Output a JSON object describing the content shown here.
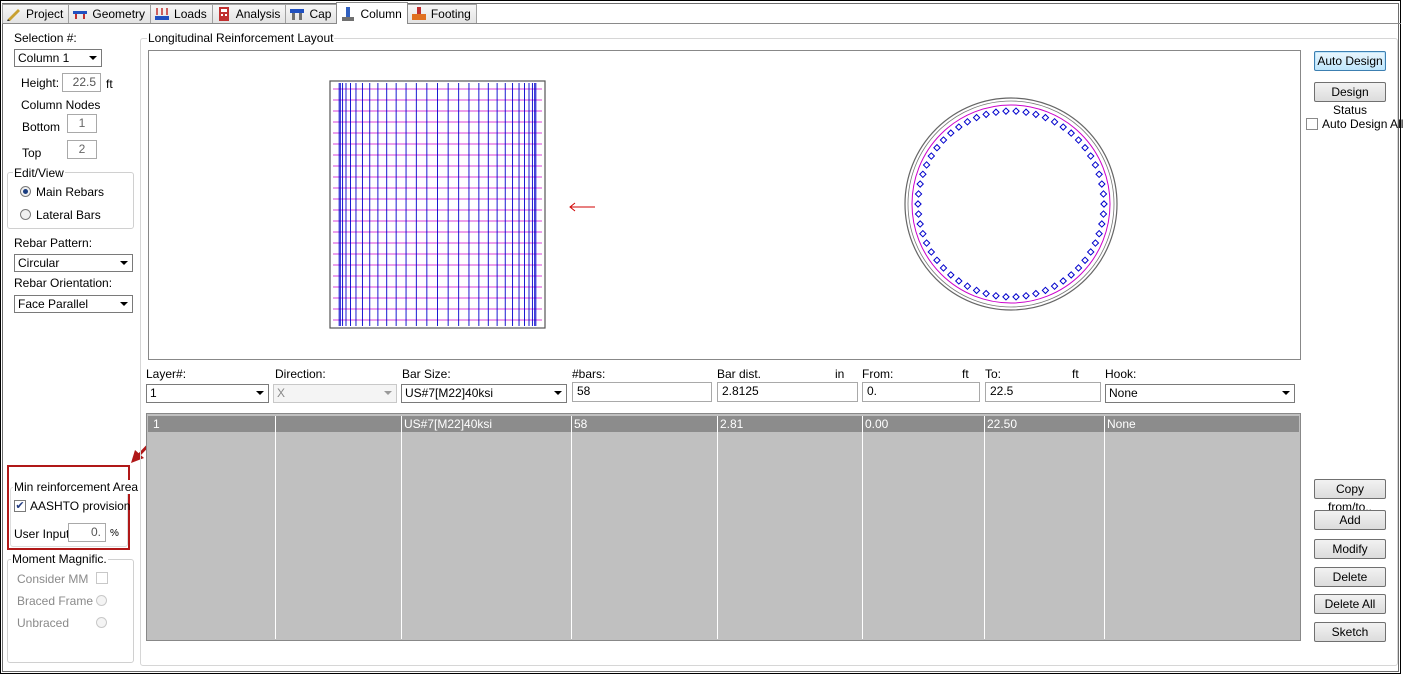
{
  "tabs": [
    {
      "label": "Project",
      "icon": "project-icon"
    },
    {
      "label": "Geometry",
      "icon": "geometry-icon"
    },
    {
      "label": "Loads",
      "icon": "loads-icon"
    },
    {
      "label": "Analysis",
      "icon": "analysis-icon"
    },
    {
      "label": "Cap",
      "icon": "cap-icon"
    },
    {
      "label": "Column",
      "icon": "column-icon",
      "active": true
    },
    {
      "label": "Footing",
      "icon": "footing-icon"
    }
  ],
  "left": {
    "selection_label": "Selection #:",
    "selection_value": "Column 1",
    "height_label": "Height:",
    "height_value": "22.5",
    "height_unit": "ft",
    "column_nodes_label": "Column Nodes",
    "bottom_label": "Bottom",
    "bottom_value": "1",
    "top_label": "Top",
    "top_value": "2",
    "edit_view_title": "Edit/View",
    "main_rebars": "Main Rebars",
    "lateral_bars": "Lateral Bars",
    "rebar_pattern_label": "Rebar Pattern:",
    "rebar_pattern_value": "Circular",
    "rebar_orientation_label": "Rebar Orientation:",
    "rebar_orientation_value": "Face Parallel",
    "min_reinf_title": "Min reinforcement Area",
    "aashto_label": "AASHTO provision",
    "aashto_checked": "✔",
    "user_input_label": "User Input:",
    "user_input_value": "0.",
    "user_input_unit": "%",
    "moment_title": "Moment Magnific.",
    "consider_mm": "Consider MM",
    "braced_frame": "Braced Frame",
    "unbraced": "Unbraced"
  },
  "layout_title": "Longitudinal  Reinforcement Layout",
  "drawing": {
    "bars_count": 58
  },
  "right": {
    "auto_design": "Auto Design",
    "design_status": "Design Status",
    "auto_design_all": "Auto Design All",
    "copy_from": "Copy from/to..",
    "add": "Add",
    "modify": "Modify",
    "delete": "Delete",
    "delete_all": "Delete All",
    "sketch": "Sketch"
  },
  "form": {
    "layer_label": "Layer#:",
    "layer_value": "1",
    "direction_label": "Direction:",
    "direction_value": "X",
    "bar_size_label": "Bar Size:",
    "bar_size_value": "US#7[M22]40ksi",
    "bars_label": "#bars:",
    "bars_value": "58",
    "bar_dist_label": "Bar dist.",
    "bar_dist_unit": "in",
    "bar_dist_value": "2.8125",
    "from_label": "From:",
    "from_unit": "ft",
    "from_value": "0.",
    "to_label": "To:",
    "to_unit": "ft",
    "to_value": "22.5",
    "hook_label": "Hook:",
    "hook_value": "None"
  },
  "table": {
    "rows": [
      [
        "1",
        "",
        "US#7[M22]40ksi",
        "58",
        "2.81",
        "0.00",
        "22.50",
        "None"
      ]
    ]
  },
  "colors": {
    "annotation_red": "#b01818",
    "selected_row": "#8c8c8c",
    "grid_bg": "#c0c0c0",
    "bar_blue": "#0000cc",
    "tie_magenta": "#cc00cc"
  }
}
